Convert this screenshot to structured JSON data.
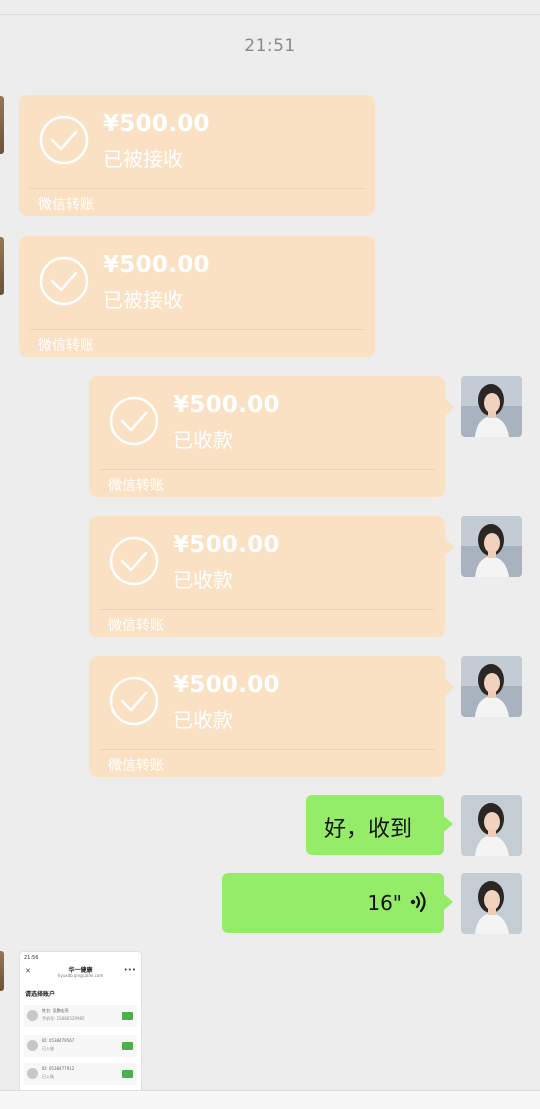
{
  "chat": {
    "timestamp": "21:51",
    "transfers": [
      {
        "amount": "¥500.00",
        "status": "已被接收",
        "footer": "微信转账",
        "side": "left"
      },
      {
        "amount": "¥500.00",
        "status": "已被接收",
        "footer": "微信转账",
        "side": "left"
      },
      {
        "amount": "¥500.00",
        "status": "已收款",
        "footer": "微信转账",
        "side": "right"
      },
      {
        "amount": "¥500.00",
        "status": "已收款",
        "footer": "微信转账",
        "side": "right"
      },
      {
        "amount": "¥500.00",
        "status": "已收款",
        "footer": "微信转账",
        "side": "right"
      }
    ],
    "text_message": "好，收到",
    "voice_message": {
      "duration": "16\""
    },
    "image_message": {
      "status_bar": "21:56",
      "title": "华一健康",
      "url": "hyuxdb.qingcaifei.com",
      "heading": "请选择账户",
      "rows": [
        {
          "line1": "姓名: 吴鹏宏亮",
          "line2": "手机号: 15686529985"
        },
        {
          "line1": "ID: 0538479567",
          "line2": "已入账"
        },
        {
          "line1": "ID: 0538477912",
          "line2": "已入账"
        }
      ]
    }
  },
  "colors": {
    "background": "#ededed",
    "transfer_bubble": "#fbe1c4",
    "sent_bubble": "#95ec69"
  }
}
